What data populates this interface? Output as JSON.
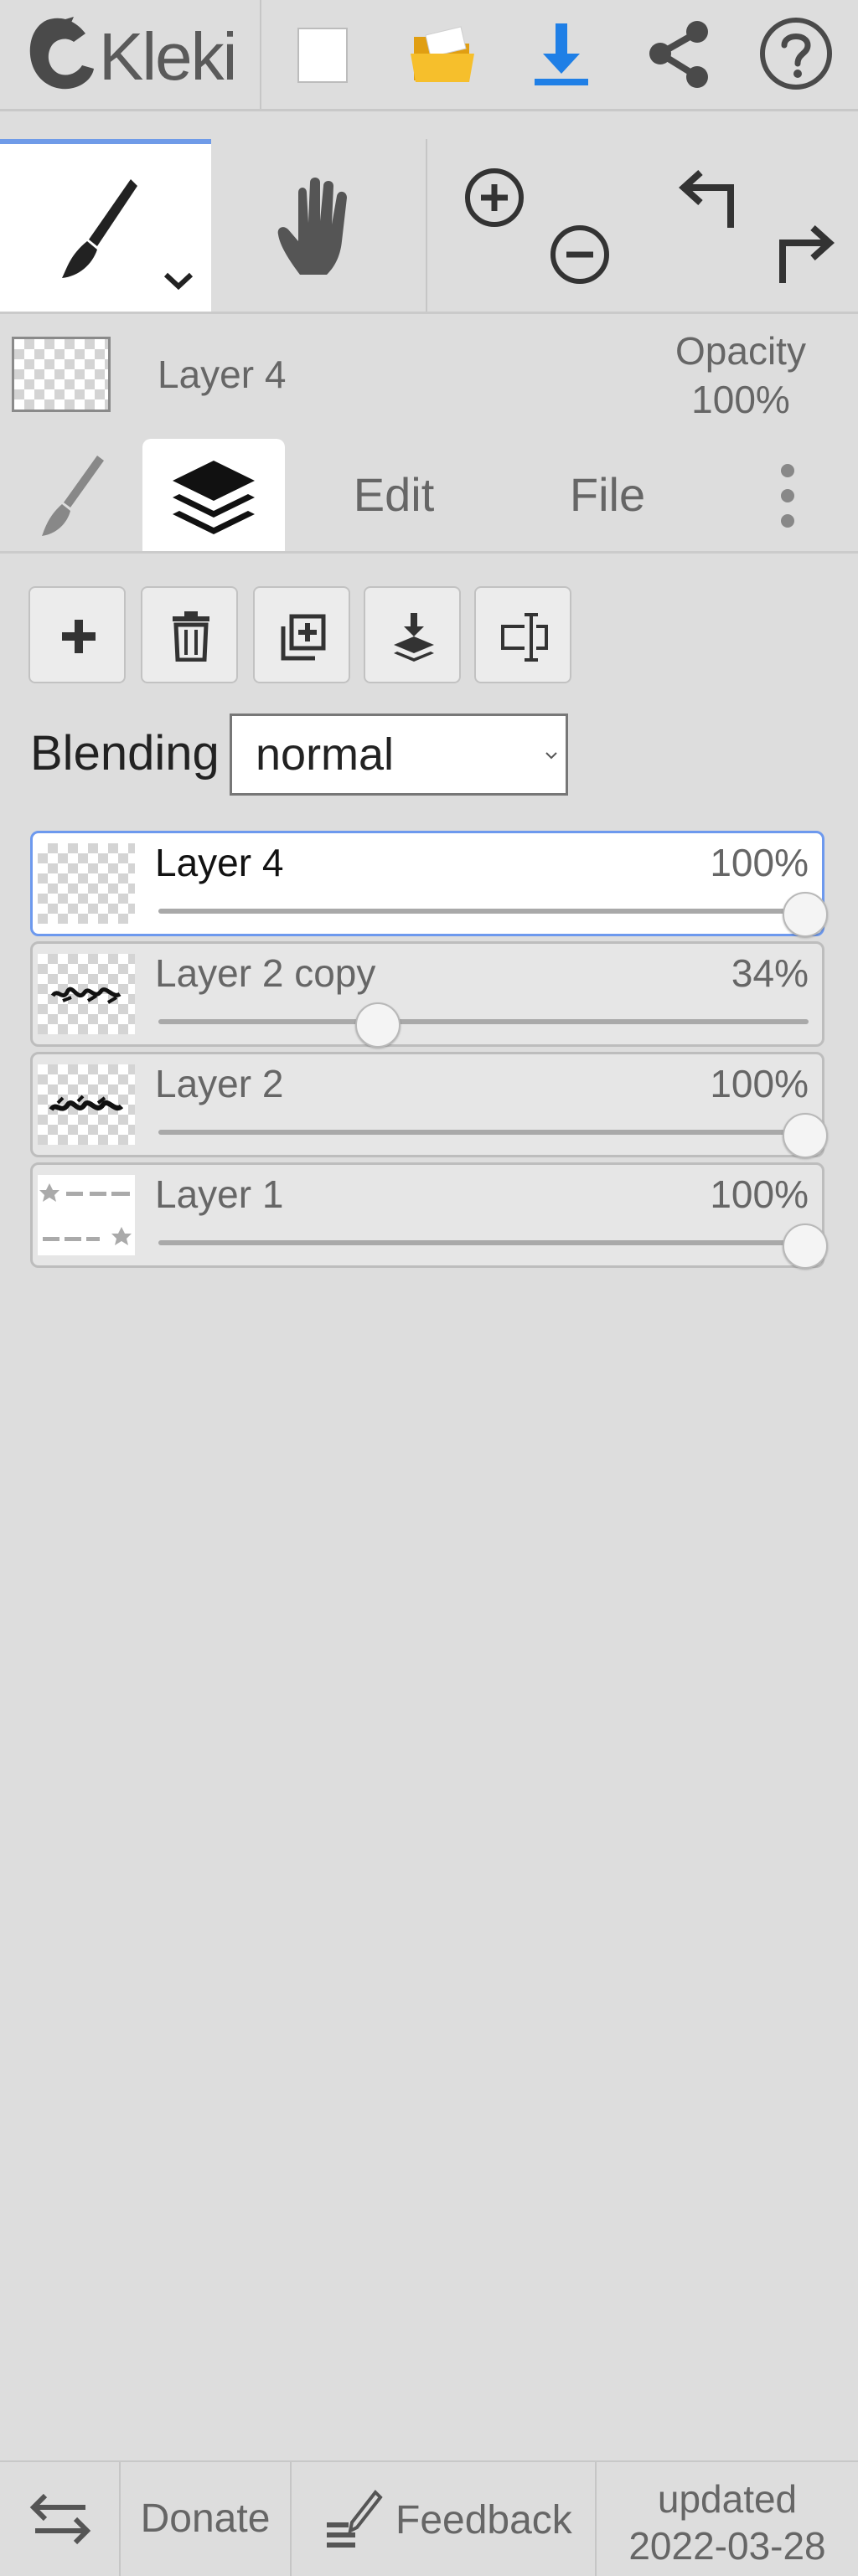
{
  "app": {
    "name": "Kleki"
  },
  "current_layer": {
    "name": "Layer 4",
    "opacity_label": "Opacity",
    "opacity_value": "100%"
  },
  "tabs": {
    "edit": "Edit",
    "file": "File"
  },
  "blending": {
    "label": "Blending",
    "value": "normal"
  },
  "layers": [
    {
      "name": "Layer 4",
      "opacity": "100%",
      "fraction": 1.0,
      "selected": true
    },
    {
      "name": "Layer 2 copy",
      "opacity": "34%",
      "fraction": 0.34,
      "selected": false
    },
    {
      "name": "Layer 2",
      "opacity": "100%",
      "fraction": 1.0,
      "selected": false
    },
    {
      "name": "Layer 1",
      "opacity": "100%",
      "fraction": 1.0,
      "selected": false
    }
  ],
  "footer": {
    "donate": "Donate",
    "feedback": "Feedback",
    "updated_label": "updated",
    "updated_date": "2022-03-28"
  },
  "colors": {
    "accent": "#6f9be8",
    "download": "#1f7fe6",
    "folder": "#f2b21c",
    "panel_bg": "#dddddd"
  },
  "icons": [
    "kleki-logo-icon",
    "new-file-icon",
    "open-folder-icon",
    "download-icon",
    "share-icon",
    "help-icon",
    "brush-icon",
    "chevron-down-icon",
    "hand-icon",
    "zoom-in-icon",
    "zoom-out-icon",
    "undo-icon",
    "redo-icon",
    "layers-icon",
    "more-icon",
    "add-layer-icon",
    "delete-layer-icon",
    "duplicate-layer-icon",
    "merge-down-icon",
    "rename-layer-icon",
    "swap-icon",
    "feedback-icon"
  ]
}
